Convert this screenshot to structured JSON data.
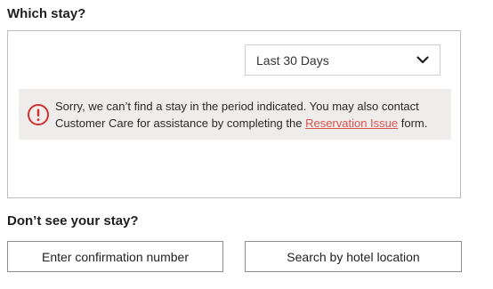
{
  "which_stay": {
    "title": "Which stay?",
    "period_select": {
      "selected": "Last 30 Days"
    },
    "alert": {
      "text_before": "Sorry, we can’t find a stay in the period indicated. You may also contact Customer Care for assistance by completing the ",
      "link": "Reservation Issue",
      "text_after": " form.",
      "icon": "exclamation-circle-icon",
      "icon_color": "#d0312d"
    }
  },
  "dont_see": {
    "title": "Don’t see your stay?",
    "confirmation_button": "Enter confirmation number",
    "hotel_button": "Search by hotel location"
  }
}
